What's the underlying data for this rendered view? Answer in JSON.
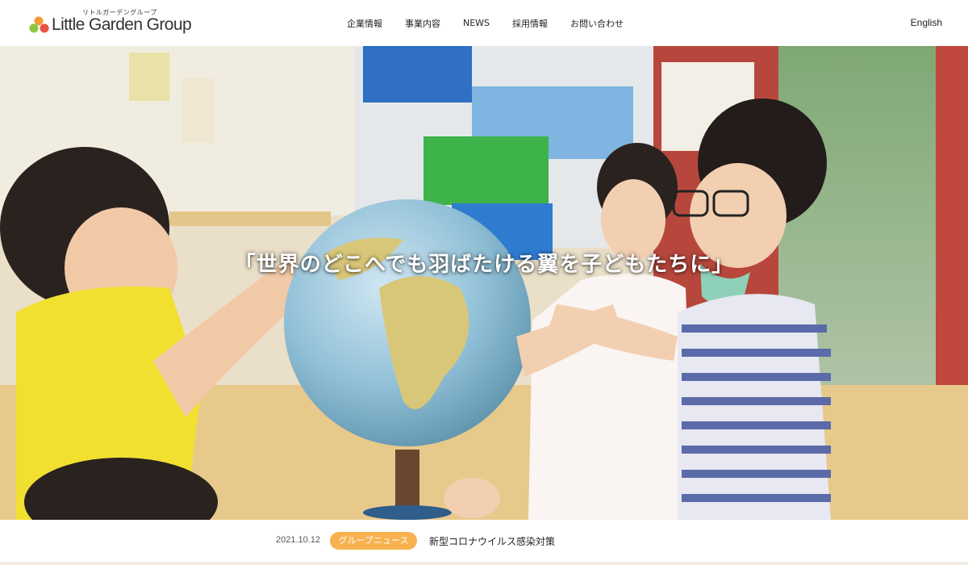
{
  "brand": {
    "kana": "リトルガーデングループ",
    "name": "Little Garden Group",
    "colors": {
      "dot_green": "#8cc63f",
      "dot_orange": "#f39c33",
      "dot_red": "#e8533f"
    }
  },
  "nav": {
    "items": [
      {
        "label": "企業情報"
      },
      {
        "label": "事業内容"
      },
      {
        "label": "NEWS"
      },
      {
        "label": "採用情報"
      },
      {
        "label": "お問い合わせ"
      }
    ],
    "language": "English"
  },
  "hero": {
    "catchphrase": "「世界のどこへでも羽ばたける翼を子どもたちに」"
  },
  "news": {
    "date": "2021.10.12",
    "category": "グループニュース",
    "category_color": "#f7b24f",
    "title": "新型コロナウイルス感染対策"
  }
}
